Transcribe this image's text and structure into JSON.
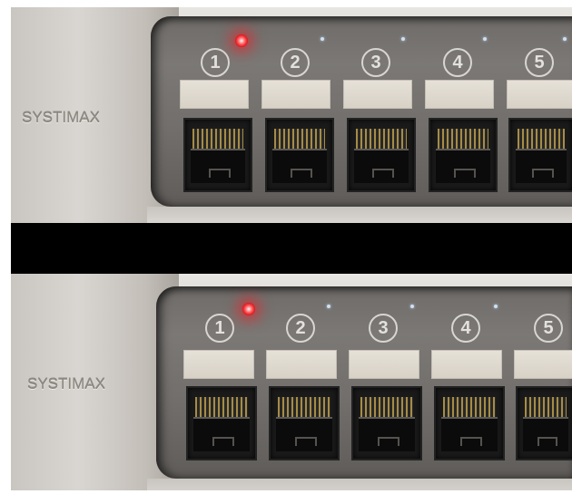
{
  "panel": {
    "brand": "SYSTIMAX",
    "ports": [
      {
        "number": "1",
        "led": "red"
      },
      {
        "number": "2",
        "led": "off"
      },
      {
        "number": "3",
        "led": "off"
      },
      {
        "number": "4",
        "led": "off"
      },
      {
        "number": "5",
        "led": "off"
      }
    ]
  },
  "colors": {
    "active_led": "#ff2a2a",
    "panel": "#757270",
    "chassis": "#cfcbc6"
  }
}
